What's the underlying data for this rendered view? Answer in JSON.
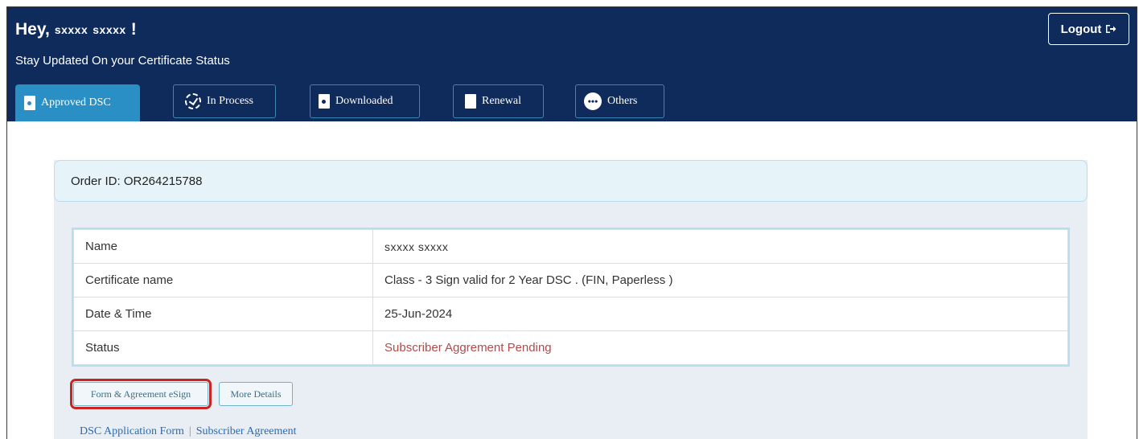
{
  "header": {
    "greeting": "Hey,",
    "first_name": "sxxxx",
    "last_name": "sxxxx",
    "exclaim": "!",
    "subtitle": "Stay Updated On your Certificate Status",
    "logout_label": "Logout"
  },
  "tabs": [
    {
      "label": "Approved DSC",
      "icon": "document-icon",
      "active": true
    },
    {
      "label": "In Process",
      "icon": "progress-icon",
      "active": false
    },
    {
      "label": "Downloaded",
      "icon": "document-icon",
      "active": false
    },
    {
      "label": "Renewal",
      "icon": "page-icon",
      "active": false
    },
    {
      "label": "Others",
      "icon": "more-icon",
      "active": false
    }
  ],
  "order": {
    "label": "Order ID: OR264215788"
  },
  "details": [
    {
      "key": "Name",
      "value": "sxxxx sxxxx"
    },
    {
      "key": "Certificate name",
      "value": "Class - 3 Sign valid for 2 Year DSC . (FIN, Paperless )"
    },
    {
      "key": "Date & Time",
      "value": "25-Jun-2024"
    },
    {
      "key": "Status",
      "value": "Subscriber Aggrement Pending"
    }
  ],
  "actions": {
    "form_esign_label": "Form & Agreement eSign",
    "more_details_label": "More Details"
  },
  "links": {
    "application_form": "DSC Application Form",
    "separator": "|",
    "subscriber_agreement": "Subscriber Agreement"
  },
  "colors": {
    "header_bg": "#0f2b5b",
    "active_tab": "#2a8fc4",
    "status_pending": "#b24a4a",
    "highlight": "#cc2222"
  }
}
